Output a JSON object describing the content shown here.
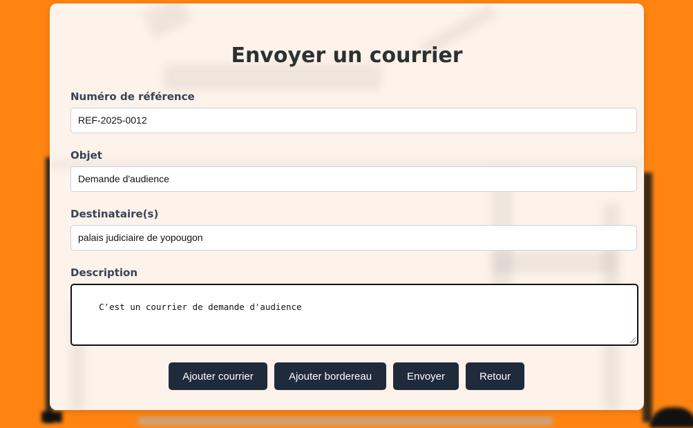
{
  "page": {
    "title": "Envoyer un courrier",
    "background_color": "#ff8412",
    "card_color": "#fdf3ea",
    "button_color": "#1f2a3b"
  },
  "form": {
    "reference": {
      "label": "Numéro de référence",
      "value": "REF-2025-0012"
    },
    "objet": {
      "label": "Objet",
      "value": "Demande d'audience"
    },
    "destinataires": {
      "label": "Destinataire(s)",
      "value": "palais judiciaire de yopougon"
    },
    "description": {
      "label": "Description",
      "value": "C'est un courrier de demande d'audience"
    }
  },
  "buttons": {
    "ajouter_courrier": "Ajouter courrier",
    "ajouter_bordereau": "Ajouter bordereau",
    "envoyer": "Envoyer",
    "retour": "Retour"
  }
}
